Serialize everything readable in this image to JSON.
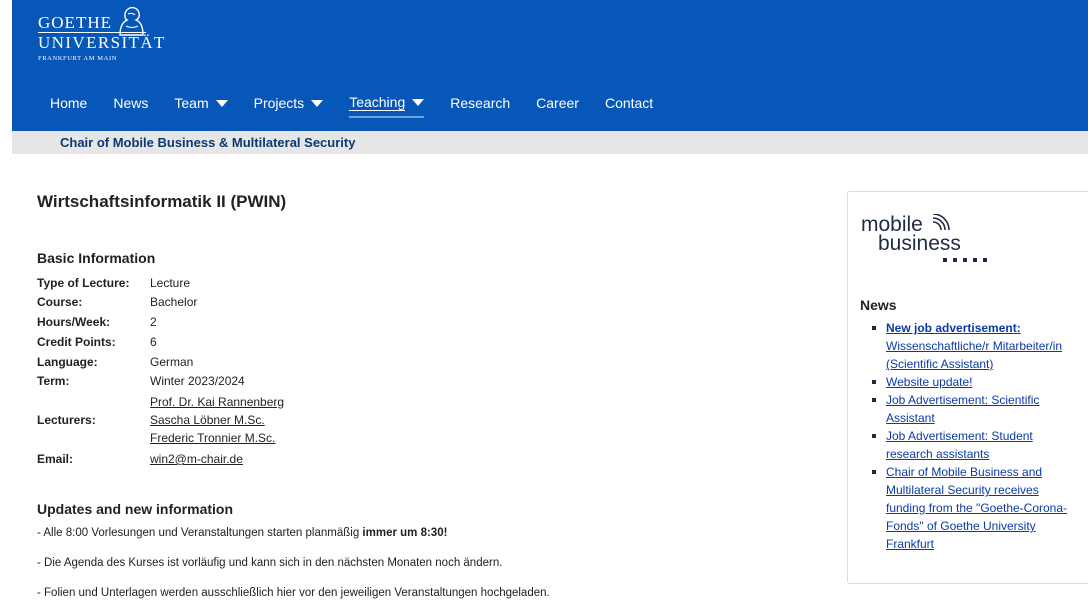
{
  "logo": {
    "line1": "GOETHE",
    "line2": "UNIVERSITÄT",
    "line3": "FRANKFURT AM MAIN"
  },
  "nav": [
    {
      "label": "Home",
      "has_dropdown": false
    },
    {
      "label": "News",
      "has_dropdown": false
    },
    {
      "label": "Team",
      "has_dropdown": true
    },
    {
      "label": "Projects",
      "has_dropdown": true
    },
    {
      "label": "Teaching",
      "has_dropdown": true,
      "active": true
    },
    {
      "label": "Research",
      "has_dropdown": false
    },
    {
      "label": "Career",
      "has_dropdown": false
    },
    {
      "label": "Contact",
      "has_dropdown": false
    }
  ],
  "subbar": {
    "title": "Chair of Mobile Business & Multilateral Security"
  },
  "main": {
    "title": "Wirtschaftsinformatik II (PWIN)",
    "basic_heading": "Basic Information",
    "info": {
      "type": {
        "label": "Type of Lecture:",
        "value": "Lecture"
      },
      "course": {
        "label": "Course:",
        "value": "Bachelor"
      },
      "hours": {
        "label": "Hours/Week:",
        "value": "2"
      },
      "credits": {
        "label": "Credit Points:",
        "value": "6"
      },
      "language": {
        "label": "Language:",
        "value": "German"
      },
      "term": {
        "label": "Term:",
        "value": "Winter 2023/2024"
      },
      "lecturers": {
        "label": "Lecturers:",
        "values": [
          "Prof. Dr. Kai Rannenberg",
          "Sascha Löbner M.Sc.",
          "Frederic Tronnier M.Sc."
        ]
      },
      "email": {
        "label": "Email:",
        "value": "win2@m-chair.de"
      }
    },
    "updates_heading": "Updates and new information",
    "updates": {
      "p1_prefix": "- Alle 8:00 Vorlesungen und Veranstaltungen starten planmäßig ",
      "p1_bold": "immer um 8:30!",
      "p2": "- Die Agenda des Kurses ist vorläufig und kann sich in den nächsten Monaten noch ändern.",
      "p3": "- Folien und Unterlagen werden ausschließlich hier vor den jeweiligen Veranstaltungen hochgeladen."
    }
  },
  "sidebar": {
    "logo": {
      "word1": "mobile",
      "word2": "business"
    },
    "news_heading": "News",
    "news": [
      {
        "line_bold": "New job advertisement:",
        "rest": [
          "Wissenschaftliche/r Mitarbeiter/in",
          "(Scientific Assistant)"
        ]
      },
      {
        "rest": [
          "Website update!"
        ]
      },
      {
        "rest": [
          "Job Advertisement: Scientific",
          "Assistant"
        ]
      },
      {
        "rest": [
          "Job Advertisement: Student",
          "research assistants"
        ]
      },
      {
        "rest": [
          "Chair of Mobile Business and",
          "Multilateral Security receives",
          "funding from the \"Goethe-Corona-",
          "Fonds\" of Goethe University",
          "Frankfurt"
        ]
      }
    ]
  },
  "colors": {
    "header_bg": "#0757b8",
    "subbar_bg": "#e6e6e6",
    "subbar_text": "#0b3a73",
    "news_link": "#0b3aa8"
  }
}
